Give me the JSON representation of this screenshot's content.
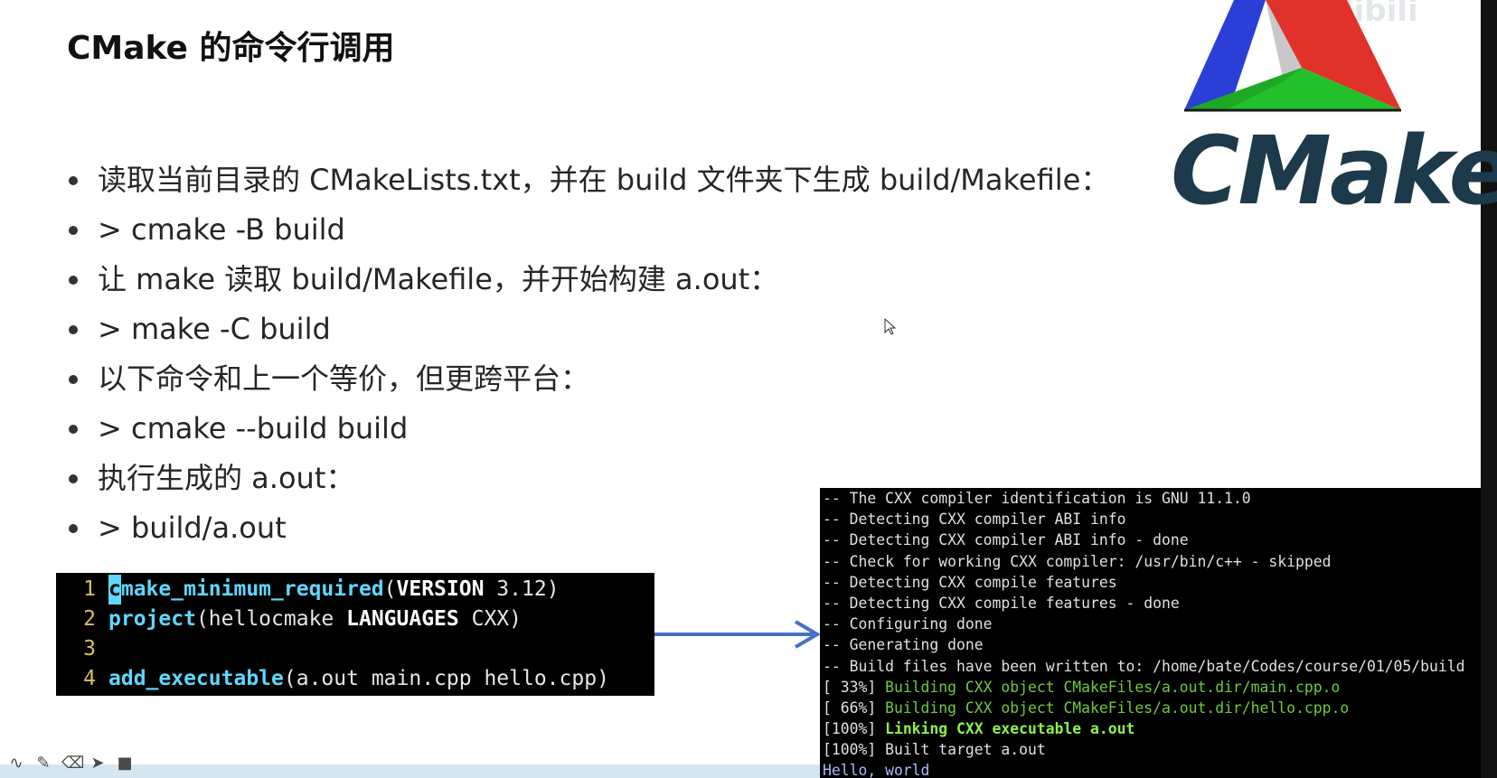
{
  "slide": {
    "title": "CMake 的命令行调用",
    "bullets": [
      "读取当前目录的 CMakeLists.txt，并在 build 文件夹下生成 build/Makefile：",
      "> cmake -B build",
      "让 make 读取 build/Makefile，并开始构建 a.out：",
      "> make -C build",
      "以下命令和上一个等价，但更跨平台：",
      "> cmake --build build",
      "执行生成的 a.out：",
      "> build/a.out"
    ]
  },
  "logo": {
    "text": "CMake"
  },
  "editor": {
    "lines": [
      {
        "num": "1",
        "cursor": "c",
        "fn": "make_minimum_required",
        "open": "(",
        "kw": "VERSION",
        "rest": " 3.12)"
      },
      {
        "num": "2",
        "fn": "project",
        "open": "(",
        "plain": "hellocmake ",
        "kw": "LANGUAGES",
        "rest": " CXX)"
      },
      {
        "num": "3"
      },
      {
        "num": "4",
        "fn": "add_executable",
        "open": "(",
        "rest": "a.out main.cpp hello.cpp)"
      }
    ]
  },
  "terminal": {
    "lines": [
      "-- The CXX compiler identification is GNU 11.1.0",
      "-- Detecting CXX compiler ABI info",
      "-- Detecting CXX compiler ABI info - done",
      "-- Check for working CXX compiler: /usr/bin/c++ - skipped",
      "-- Detecting CXX compile features",
      "-- Detecting CXX compile features - done",
      "-- Configuring done",
      "-- Generating done",
      "-- Build files have been written to: /home/bate/Codes/course/01/05/build"
    ],
    "progress": [
      {
        "pct": "[ 33%] ",
        "msg": "Building CXX object CMakeFiles/a.out.dir/main.cpp.o",
        "style": "green"
      },
      {
        "pct": "[ 66%] ",
        "msg": "Building CXX object CMakeFiles/a.out.dir/hello.cpp.o",
        "style": "green"
      },
      {
        "pct": "[100%] ",
        "msg": "Linking CXX executable a.out",
        "style": "green-b"
      },
      {
        "pct": "[100%] ",
        "msg": "Built target a.out",
        "style": "plain"
      }
    ],
    "output": "Hello, world"
  },
  "colors": {
    "arrow": "#4472c4",
    "logo_text": "#1d3a4a"
  }
}
